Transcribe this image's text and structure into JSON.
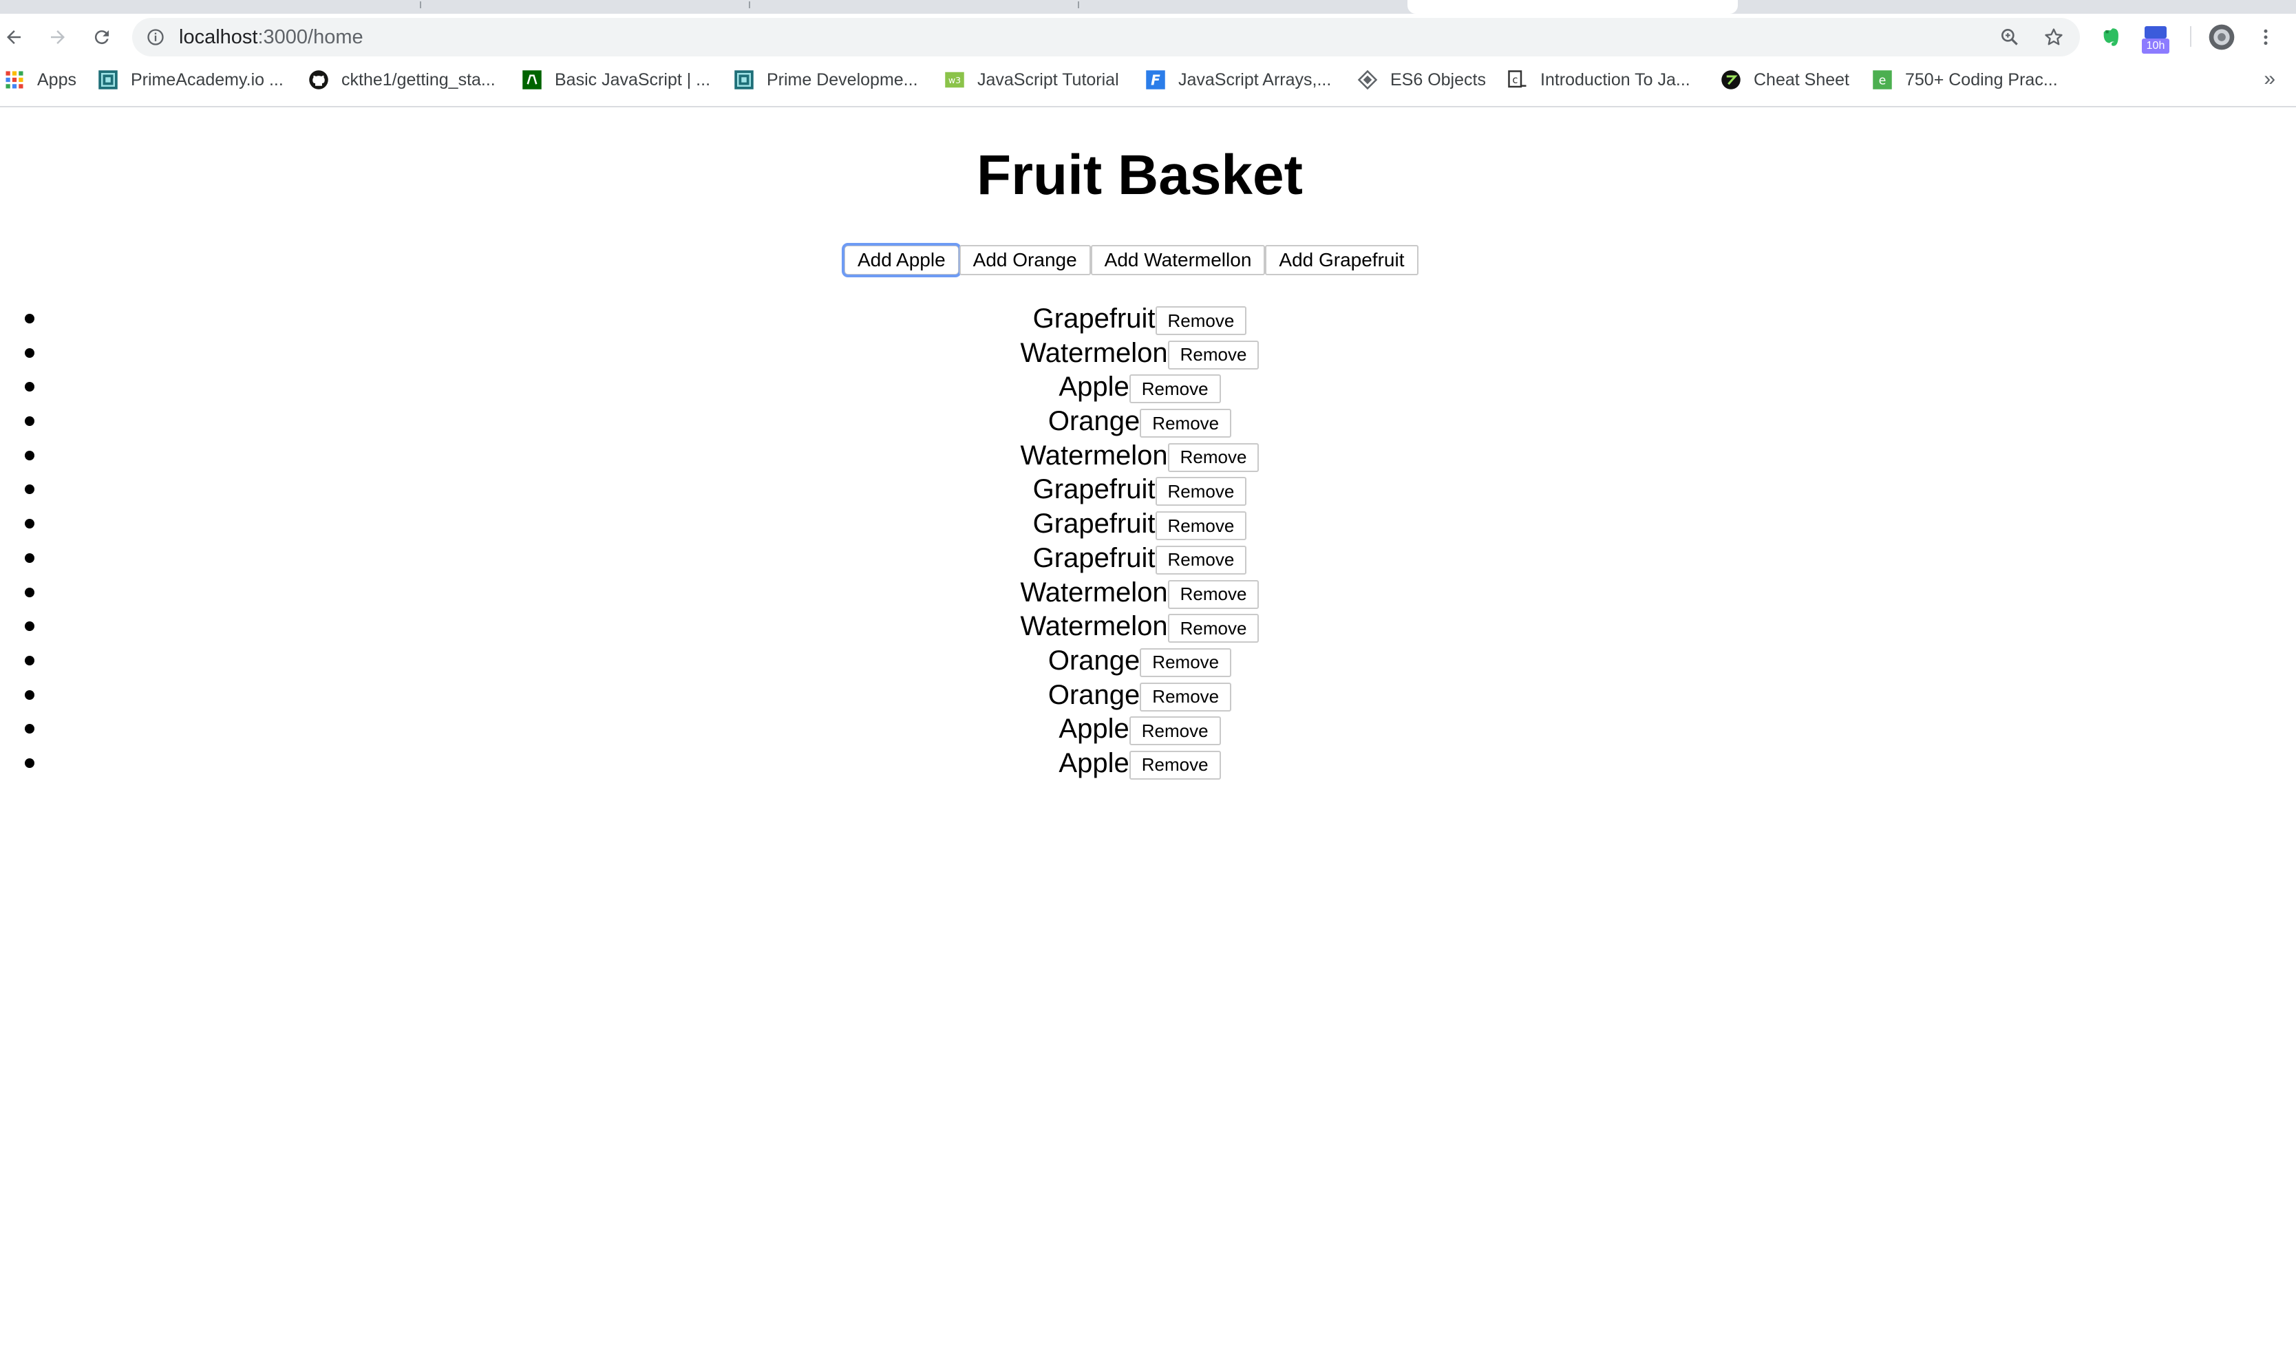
{
  "browser": {
    "url_host": "localhost",
    "url_path": ":3000/home",
    "extension_badge": "10h",
    "bookmarks": [
      {
        "label": "Apps",
        "icon": "apps-grid-icon"
      },
      {
        "label": "PrimeAcademy.io ...",
        "icon": "prime-icon"
      },
      {
        "label": "ckthe1/getting_sta...",
        "icon": "github-icon"
      },
      {
        "label": "Basic JavaScript | ...",
        "icon": "fcc-icon"
      },
      {
        "label": "Prime Developme...",
        "icon": "prime-icon"
      },
      {
        "label": "JavaScript Tutorial",
        "icon": "w3schools-icon"
      },
      {
        "label": "JavaScript Arrays,...",
        "icon": "f-icon"
      },
      {
        "label": "ES6 Objects",
        "icon": "diamond-icon"
      },
      {
        "label": "Introduction To Ja...",
        "icon": "c-icon"
      },
      {
        "label": "Cheat Sheet",
        "icon": "cheat-sheet-icon"
      },
      {
        "label": "750+ Coding Prac...",
        "icon": "e-icon"
      }
    ],
    "bookmarks_overflow": "»"
  },
  "page": {
    "title": "Fruit Basket",
    "add_buttons": [
      {
        "label": "Add Apple"
      },
      {
        "label": "Add Orange"
      },
      {
        "label": "Add Watermellon"
      },
      {
        "label": "Add Grapefruit"
      }
    ],
    "remove_label": "Remove",
    "fruits": [
      "Grapefruit",
      "Watermelon",
      "Apple",
      "Orange",
      "Watermelon",
      "Grapefruit",
      "Grapefruit",
      "Grapefruit",
      "Watermelon",
      "Watermelon",
      "Orange",
      "Orange",
      "Apple",
      "Apple"
    ]
  },
  "colors": {
    "focus_ring": "#6e9bf4",
    "omnibox_bg": "#f1f3f4",
    "tabstrip_bg": "#dee1e6"
  }
}
